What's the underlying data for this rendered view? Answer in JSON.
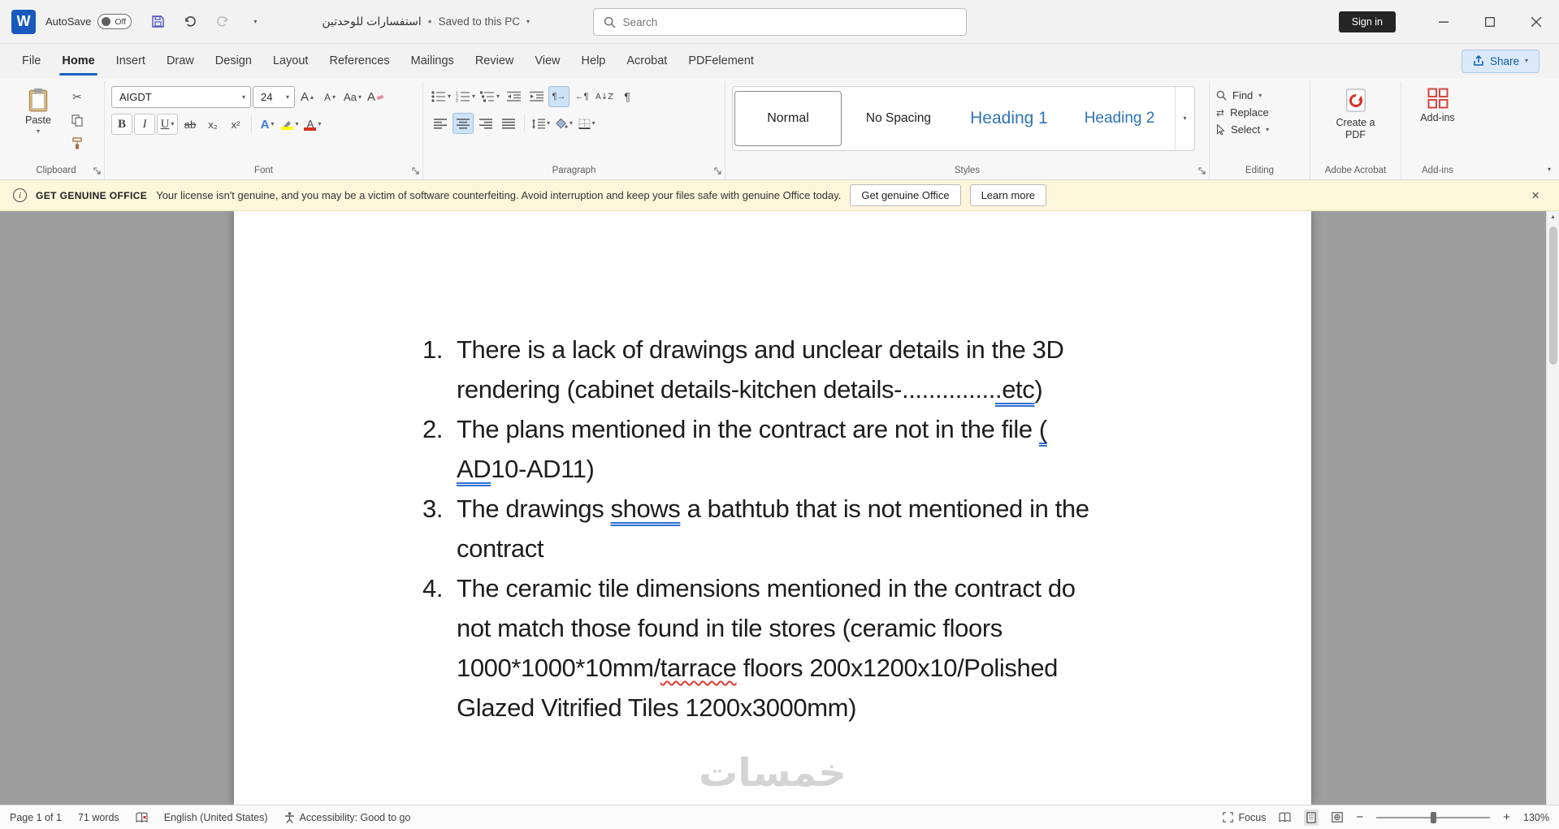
{
  "icons": {
    "chevron_down": "▾",
    "chevron_up": "▴",
    "cut": "✂",
    "pilcrow": "¶",
    "sort": "A↓Z",
    "dir_ltr": "¶→",
    "dir_rtl": "←¶",
    "replace": "⇄"
  },
  "titlebar": {
    "autosave_label": "AutoSave",
    "autosave_state": "Off",
    "doc_title": "استفسارات للوحدتين",
    "title_separator": "•",
    "saved_status": "Saved to this PC",
    "search_placeholder": "Search",
    "sign_in_label": "Sign in"
  },
  "tabs": [
    "File",
    "Home",
    "Insert",
    "Draw",
    "Design",
    "Layout",
    "References",
    "Mailings",
    "Review",
    "View",
    "Help",
    "Acrobat",
    "PDFelement"
  ],
  "share_label": "Share",
  "ribbon": {
    "clipboard": {
      "group_label": "Clipboard",
      "paste_label": "Paste"
    },
    "font": {
      "group_label": "Font",
      "font_name": "AIGDT",
      "font_size": "24",
      "grow_font": "A",
      "shrink_font": "A",
      "change_case": "Aa",
      "clear_format": "A",
      "bold": "B",
      "italic": "I",
      "underline": "U",
      "strikethrough": "ab",
      "subscript": "x₂",
      "superscript": "x²",
      "text_effects": "A",
      "font_color": "A"
    },
    "paragraph": {
      "group_label": "Paragraph"
    },
    "styles": {
      "group_label": "Styles",
      "items": [
        "Normal",
        "No Spacing",
        "Heading 1",
        "Heading 2"
      ]
    },
    "editing": {
      "group_label": "Editing",
      "find_label": "Find",
      "replace_label": "Replace",
      "select_label": "Select"
    },
    "acrobat": {
      "group_label": "Adobe Acrobat",
      "button_label": "Create a PDF"
    },
    "addins": {
      "group_label": "Add-ins",
      "button_label": "Add-ins"
    }
  },
  "banner": {
    "title": "GET GENUINE OFFICE",
    "message": "Your license isn't genuine, and you may be a victim of software counterfeiting. Avoid interruption and keep your files safe with genuine Office today.",
    "get_genuine_label": "Get genuine Office",
    "learn_more_label": "Learn more"
  },
  "document": {
    "items": [
      {
        "number": "1.",
        "lines": [
          [
            {
              "text": "There is a lack of drawings and unclear details in the 3D"
            }
          ],
          [
            {
              "text": "rendering (cabinet details-kitchen details-.............."
            },
            {
              "text": ".etc",
              "style": "grammar"
            },
            {
              "text": ")"
            }
          ]
        ]
      },
      {
        "number": "2.",
        "lines": [
          [
            {
              "text": "The plans mentioned in the contract are not in the file "
            },
            {
              "text": "(",
              "style": "grammar"
            }
          ],
          [
            {
              "text": "AD",
              "style": "grammar"
            },
            {
              "text": "10-AD11)"
            }
          ]
        ]
      },
      {
        "number": "3.",
        "lines": [
          [
            {
              "text": "The drawings "
            },
            {
              "text": "shows",
              "style": "grammar"
            },
            {
              "text": " a bathtub that is not mentioned in the"
            }
          ],
          [
            {
              "text": "contract"
            }
          ]
        ]
      },
      {
        "number": "4.",
        "lines": [
          [
            {
              "text": "The ceramic tile dimensions mentioned in the contract do"
            }
          ],
          [
            {
              "text": "not match those found in tile stores (ceramic floors"
            }
          ],
          [
            {
              "text": "1000*1000*10mm/"
            },
            {
              "text": "tarrace",
              "style": "spelling"
            },
            {
              "text": " floors 200x1200x10/Polished"
            }
          ],
          [
            {
              "text": "Glazed Vitrified Tiles 1200x3000mm)"
            }
          ]
        ]
      }
    ],
    "watermark": "خمسات"
  },
  "statusbar": {
    "page_info": "Page 1 of 1",
    "word_count": "71 words",
    "language": "English (United States)",
    "accessibility": "Accessibility: Good to go",
    "focus_label": "Focus",
    "zoom_level": "130%"
  }
}
